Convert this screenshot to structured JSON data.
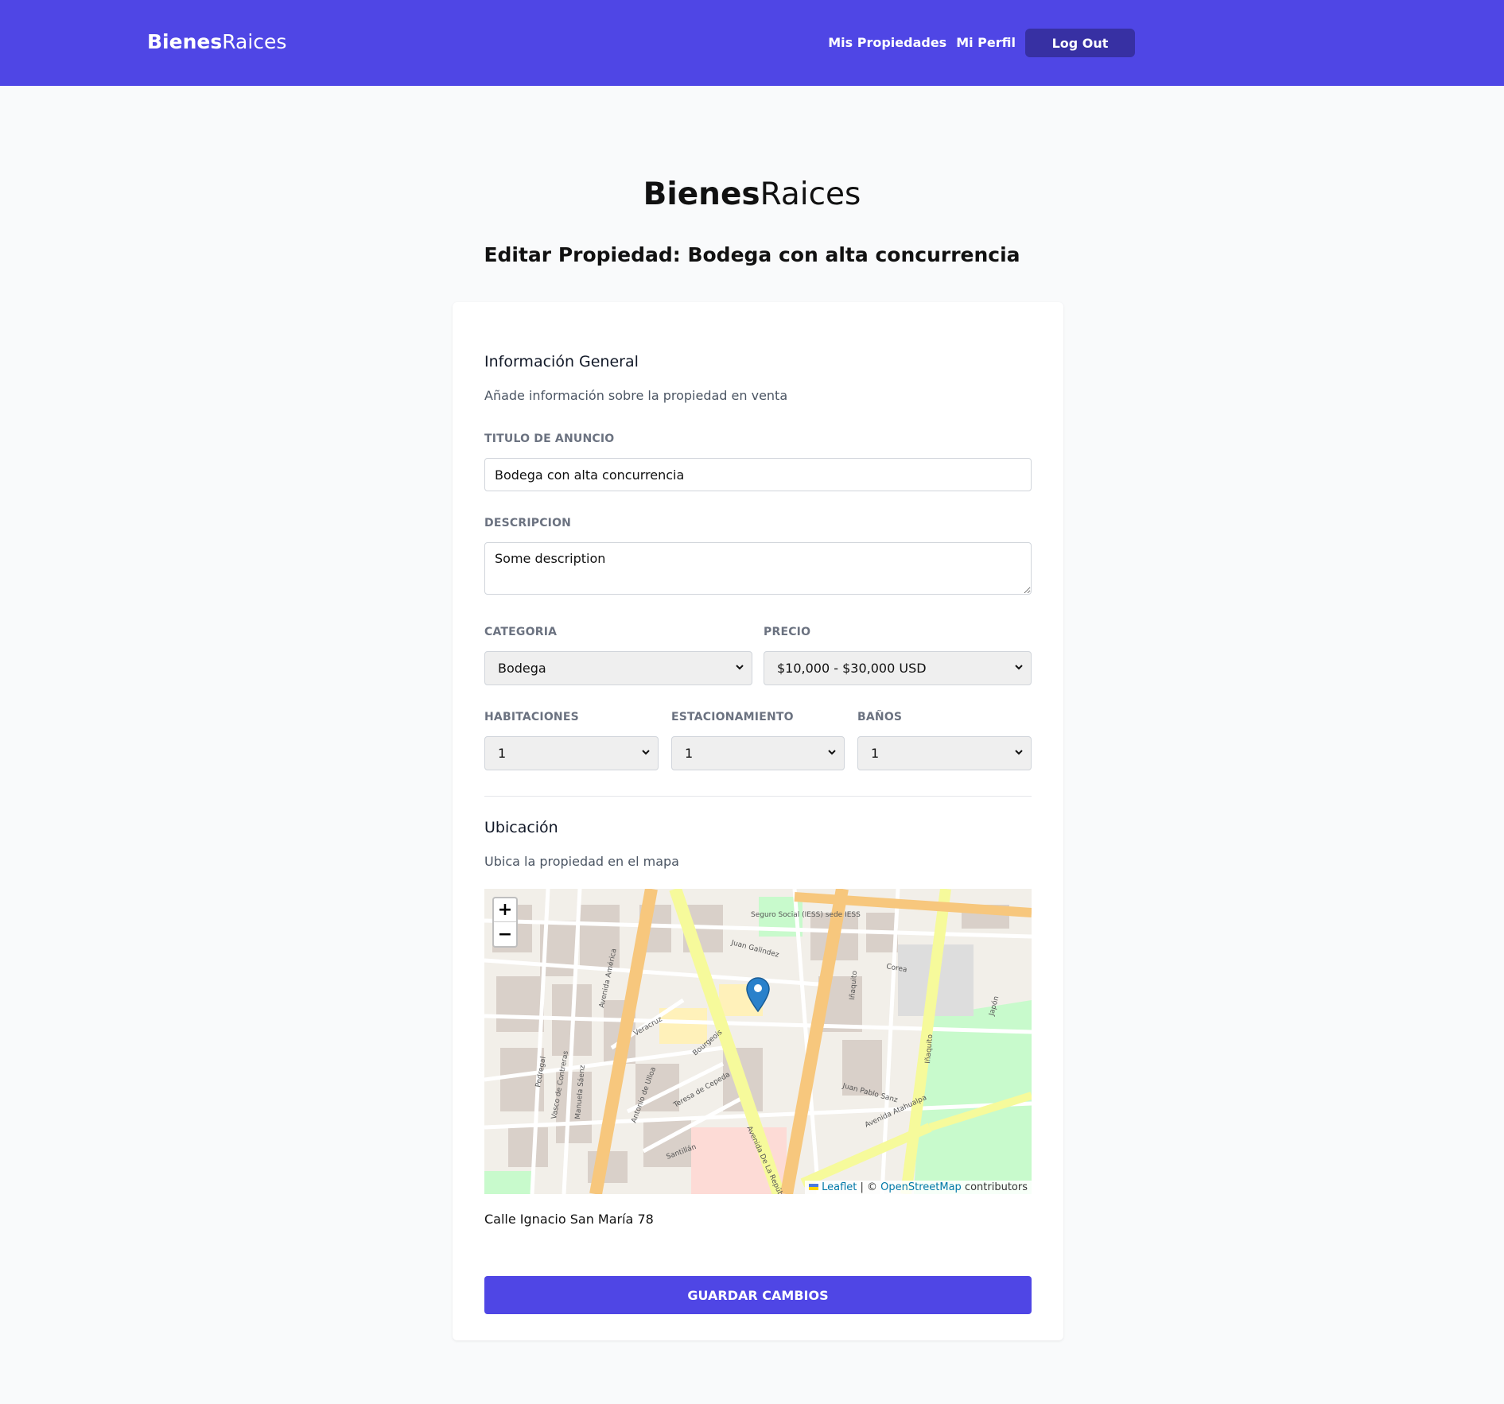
{
  "header": {
    "brand_bold": "Bienes",
    "brand_light": "Raices",
    "nav": [
      {
        "label": "Mis Propiedades"
      },
      {
        "label": "Mi Perfil"
      }
    ],
    "logout_label": "Log Out"
  },
  "page": {
    "brand_bold": "Bienes",
    "brand_light": "Raices",
    "title": "Editar Propiedad: Bodega con alta concurrencia"
  },
  "form": {
    "general": {
      "title": "Información General",
      "subtitle": "Añade información sobre la propiedad en venta"
    },
    "titulo": {
      "label": "TITULO DE ANUNCIO",
      "value": "Bodega con alta concurrencia"
    },
    "descripcion": {
      "label": "DESCRIPCION",
      "value": "Some description"
    },
    "categoria": {
      "label": "CATEGORIA",
      "value": "Bodega"
    },
    "precio": {
      "label": "PRECIO",
      "value": "$10,000 - $30,000 USD"
    },
    "habitaciones": {
      "label": "HABITACIONES",
      "value": "1"
    },
    "estacionamiento": {
      "label": "ESTACIONAMIENTO",
      "value": "1"
    },
    "banos": {
      "label": "BAÑOS",
      "value": "1"
    },
    "ubicacion": {
      "title": "Ubicación",
      "subtitle": "Ubica la propiedad en el mapa"
    },
    "map": {
      "zoom_in": "+",
      "zoom_out": "−",
      "attribution_leaflet": "Leaflet",
      "attribution_sep": " | © ",
      "attribution_osm": "OpenStreetMap",
      "attribution_tail": " contributors",
      "street_labels": [
        "Avenida América",
        "Veracruz",
        "Bourgeois",
        "Juan Galindez",
        "Iñaquito",
        "Corea",
        "Juan Pablo Sanz",
        "Avenida Atahualpa",
        "Avenida De La República",
        "Teresa de Cepeda",
        "Antonio de Ulloa",
        "Vasco de Contreras",
        "Manuela Sáenz",
        "Pedregal",
        "Santillán",
        "Japón",
        "Seguro Social (IESS) sede IESS",
        "Iñaquito"
      ]
    },
    "address": "Calle Ignacio San María 78",
    "save_label": "GUARDAR CAMBIOS"
  },
  "colors": {
    "primary": "#4f46e5",
    "primary_dark": "#3730a3",
    "marker": "#2a81cb"
  },
  "icons": [
    "chevron-down-icon",
    "map-marker-icon",
    "ukraine-flag-icon"
  ]
}
